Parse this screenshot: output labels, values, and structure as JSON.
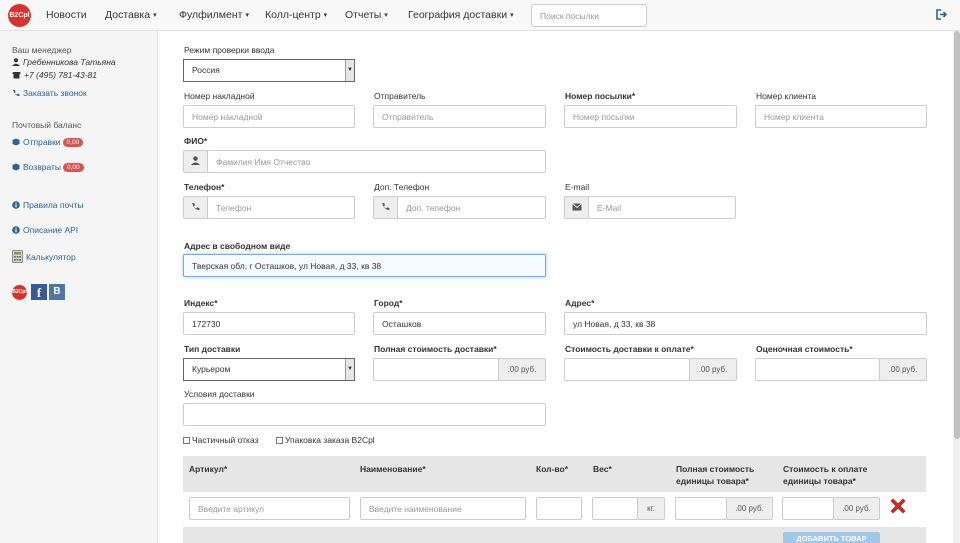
{
  "navbar": {
    "logo": "B2Cpl",
    "items": [
      {
        "label": "Новости",
        "caret": false
      },
      {
        "label": "Доставка",
        "caret": true
      },
      {
        "label": "Фулфилмент",
        "caret": true
      },
      {
        "label": "Колл-центр",
        "caret": true
      },
      {
        "label": "Отчеты",
        "caret": true
      },
      {
        "label": "География доставки",
        "caret": true
      }
    ],
    "caret_glyph": "▾",
    "search_placeholder": "Поиск посылки",
    "logout_icon": "logout-icon"
  },
  "sidebar": {
    "manager_title": "Ваш менеджер",
    "manager_name": "Гребенникова Татьяна",
    "manager_phone": "+7 (495) 781-43-81",
    "call_link": "Заказать звонок",
    "balance_title": "Почтовый баланс",
    "shipments_label": "Отправки",
    "shipments_badge": "0,00",
    "returns_label": "Возвраты",
    "returns_badge": "0,00",
    "rules_link": "Правила почты",
    "api_link": "Описание API",
    "calc_link": "Калькулятор",
    "social": {
      "b2c": "B2Cpl",
      "fb": "f",
      "vk": "B"
    }
  },
  "form": {
    "check_mode_label": "Режим проверки ввода",
    "check_mode_value": "Россия",
    "waybill_label": "Номер накладной",
    "waybill_placeholder": "Номер накладной",
    "sender_label": "Отправитель",
    "sender_placeholder": "Отправитель",
    "parcel_label": "Номер посылки*",
    "parcel_placeholder": "Номер посылки",
    "client_label": "Номер клиента",
    "client_placeholder": "Номер клиента",
    "fio_label": "ФИО*",
    "fio_placeholder": "Фамилия Имя Отчество",
    "phone_label": "Телефон*",
    "phone_placeholder": "Телефон",
    "phone2_label": "Доп. Телефон",
    "phone2_placeholder": "Доп. телефон",
    "email_label": "E-mail",
    "email_placeholder": "E-Mail",
    "free_address_label": "Адрес в свободном виде",
    "free_address_value": "Тверская обл, г Осташков, ул Новая, д 33, кв 38",
    "index_label": "Индекс*",
    "index_value": "172730",
    "city_label": "Город*",
    "city_value": "Осташков",
    "address_label": "Адрес*",
    "address_value": "ул Новая, д 33, кв 38",
    "delivery_type_label": "Тип доставки",
    "delivery_type_value": "Курьером",
    "full_cost_label": "Полная стоимость доставки*",
    "pay_cost_label": "Стоимость доставки к оплате*",
    "estimated_cost_label": "Оценочная стоимость*",
    "rub_addon": ".00 руб.",
    "conditions_label": "Условия доставки",
    "partial_refusal_label": "Частичный отказ",
    "packaging_label": "Упаковка заказа B2Cpl"
  },
  "items_table": {
    "headers": {
      "article": "Артикул*",
      "name": "Наименование*",
      "qty": "Кол-во*",
      "weight": "Вес*",
      "unit_full_cost_1": "Полная стоимость",
      "unit_full_cost_2": "единицы товара*",
      "unit_pay_cost_1": "Стоимость к оплате",
      "unit_pay_cost_2": "единицы товара*"
    },
    "article_placeholder": "Введите артикул",
    "name_placeholder": "Введите наименование",
    "kg_addon": "кг.",
    "rub_addon": ".00 руб.",
    "add_button": "ДОБАВИТЬ ТОВАР"
  },
  "colors": {
    "accent_red": "#d9322e",
    "link": "#2a6496",
    "badge": "#d9534f",
    "focus": "#66afe9"
  }
}
